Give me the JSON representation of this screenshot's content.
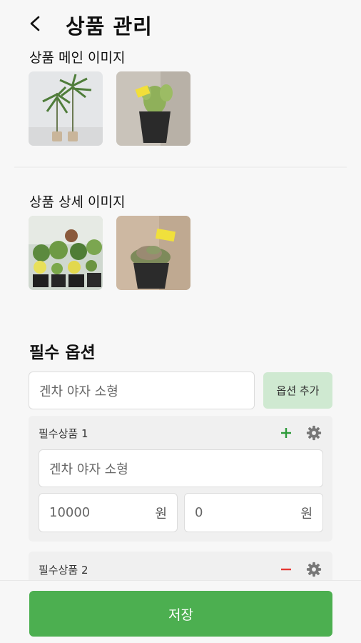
{
  "header": {
    "title": "상품 관리",
    "back_icon": "chevron-left-icon"
  },
  "main_images": {
    "label": "상품 메인 이미지",
    "items": [
      "palm-plant-image",
      "cactus-plant-image"
    ]
  },
  "detail_images": {
    "label": "상품 상세 이미지",
    "items": [
      "succulent-group-image",
      "succulent-pot-image"
    ]
  },
  "required_options": {
    "title": "필수 옵션",
    "new_option_input": "겐차 야자 소형",
    "add_button_label": "옵션 추가",
    "items": [
      {
        "label": "필수상품 1",
        "name_value": "겐차 야자 소형",
        "price_value": "10000",
        "price_unit": "원",
        "extra_value": "0",
        "extra_unit": "원",
        "action_icon": "plus-icon",
        "settings_icon": "gear-icon"
      },
      {
        "label": "필수상품 2",
        "action_icon": "minus-icon",
        "settings_icon": "gear-icon"
      }
    ]
  },
  "footer": {
    "save_label": "저장"
  },
  "colors": {
    "accent": "#4caf50",
    "plus": "#2e9b3a",
    "minus": "#e53935",
    "add_button_bg": "#cfe9d1"
  }
}
